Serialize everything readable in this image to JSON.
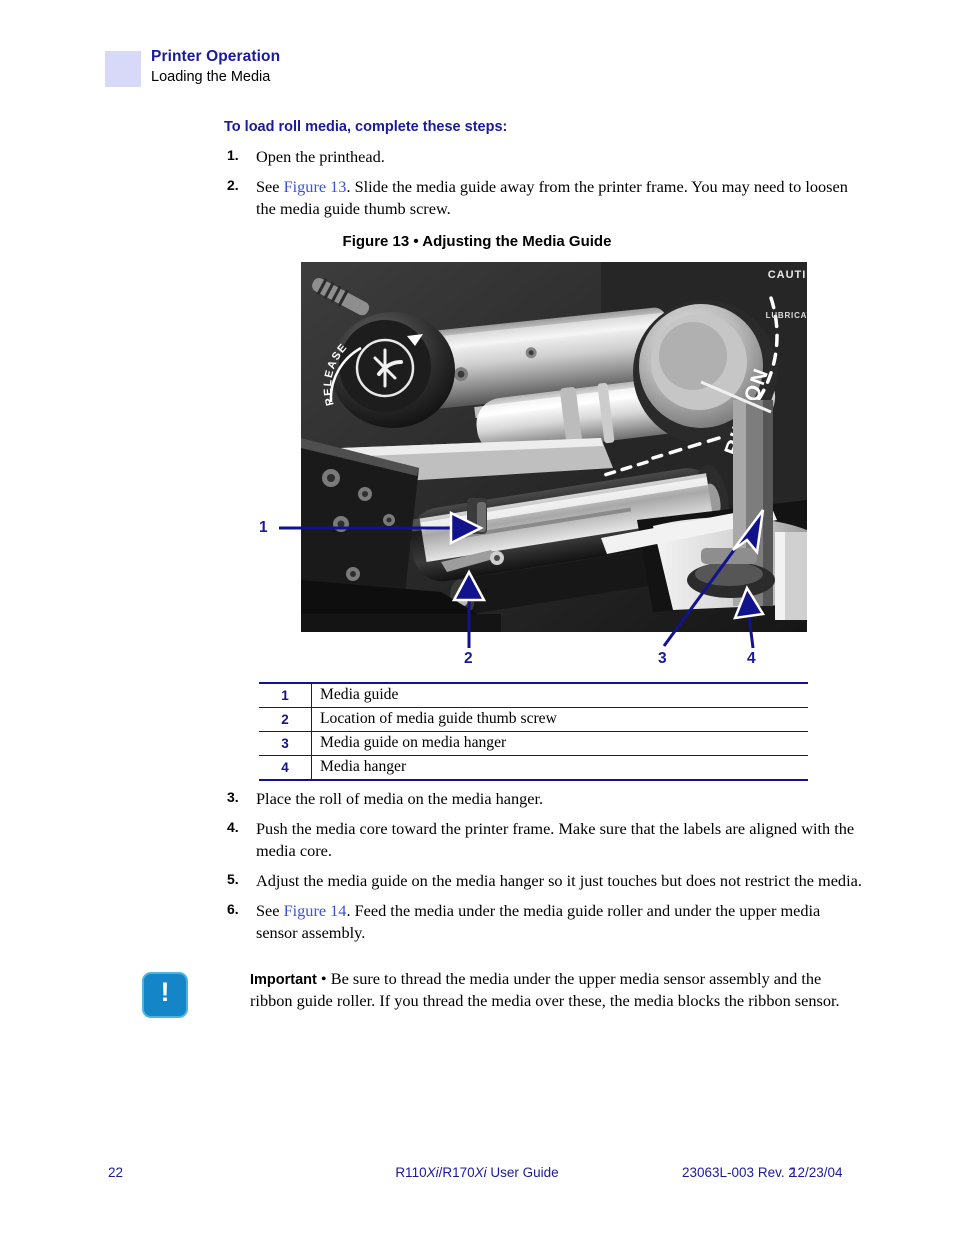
{
  "header": {
    "chapter": "Printer Operation",
    "section": "Loading the Media",
    "swatch_color": "#d8d8f8",
    "accent_color": "#1a1a9e"
  },
  "task": {
    "heading": "To load roll media, complete these steps:",
    "steps_top": [
      {
        "num": "1.",
        "pre": "Open the printhead.",
        "xref": "",
        "post": ""
      },
      {
        "num": "2.",
        "pre": "See ",
        "xref": "Figure 13",
        "post": ". Slide the media guide away from the printer frame. You may need to loosen the media guide thumb screw."
      }
    ],
    "steps_bottom": [
      {
        "num": "3.",
        "pre": "Place the roll of media on the media hanger.",
        "xref": "",
        "post": ""
      },
      {
        "num": "4.",
        "pre": "Push the media core toward the printer frame. Make sure that the labels are aligned with the media core.",
        "xref": "",
        "post": ""
      },
      {
        "num": "5.",
        "pre": "Adjust the media guide on the media hanger so it just touches but does not restrict the media.",
        "xref": "",
        "post": ""
      },
      {
        "num": "6.",
        "pre": "See ",
        "xref": "Figure 14",
        "post": ". Feed the media under the media guide roller and under the upper media sensor assembly."
      }
    ]
  },
  "figure": {
    "caption": "Figure 13 • Adjusting the Media Guide",
    "photo_labels": {
      "release": "RELEASE",
      "ribbon": "RIBBON",
      "caution": "CAUTION",
      "lubricate": "LUBRICATE"
    },
    "callouts": [
      {
        "num": "1"
      },
      {
        "num": "2"
      },
      {
        "num": "3"
      },
      {
        "num": "4"
      }
    ]
  },
  "legend": {
    "rows": [
      {
        "num": "1",
        "desc": "Media guide"
      },
      {
        "num": "2",
        "desc": "Location of media guide thumb screw"
      },
      {
        "num": "3",
        "desc": "Media guide on media hanger"
      },
      {
        "num": "4",
        "desc": "Media hanger"
      }
    ]
  },
  "note": {
    "icon_glyph": "!",
    "label": "Important",
    "bullet": " • ",
    "text": "Be sure to thread the media under the upper media sensor assembly and the ribbon guide roller. If you thread the media over these, the media blocks the ribbon sensor."
  },
  "footer": {
    "page_number": "22",
    "title_part1": "R110",
    "title_xi1": "Xi",
    "title_part2": "/R170",
    "title_xi2": "Xi",
    "title_part3": " User Guide",
    "doc_number": "23063L-003 Rev. 2",
    "date": "12/23/04",
    "color": "#1a1a9e"
  }
}
